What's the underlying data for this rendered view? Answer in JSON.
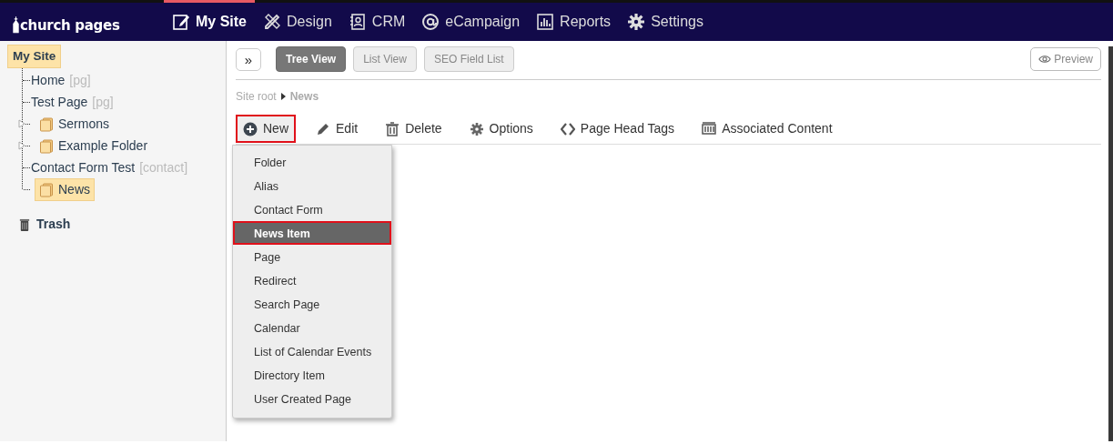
{
  "brand": "church pages",
  "nav": [
    {
      "label": "My Site",
      "selected": true
    },
    {
      "label": "Design",
      "selected": false
    },
    {
      "label": "CRM",
      "selected": false
    },
    {
      "label": "eCampaign",
      "selected": false
    },
    {
      "label": "Reports",
      "selected": false
    },
    {
      "label": "Settings",
      "selected": false
    }
  ],
  "tree": {
    "label": "My Site",
    "selected": true,
    "children": [
      {
        "label": "Home",
        "tag": "[pg]",
        "kind": "page",
        "collapsible": false,
        "selected": false
      },
      {
        "label": "Test Page",
        "tag": "[pg]",
        "kind": "page",
        "collapsible": false,
        "selected": false
      },
      {
        "label": "Sermons",
        "kind": "folder",
        "collapsible": true,
        "selected": false
      },
      {
        "label": "Example Folder",
        "kind": "folder",
        "collapsible": true,
        "selected": false
      },
      {
        "label": "Contact Form Test",
        "tag": "[contact]",
        "kind": "page",
        "collapsible": false,
        "selected": false
      },
      {
        "label": "News",
        "kind": "folder",
        "collapsible": false,
        "selected": true
      }
    ]
  },
  "trash": "Trash",
  "expand_button": "»",
  "view_tabs": [
    {
      "label": "Tree View",
      "selected": true
    },
    {
      "label": "List View",
      "selected": false
    },
    {
      "label": "SEO Field List",
      "selected": false
    }
  ],
  "preview": "Preview",
  "breadcrumb": [
    "Site root",
    "News"
  ],
  "toolbar": [
    {
      "label": "New",
      "highlighted": true
    },
    {
      "label": "Edit",
      "highlighted": false
    },
    {
      "label": "Delete",
      "highlighted": false
    },
    {
      "label": "Options",
      "highlighted": false
    },
    {
      "label": "Page Head Tags",
      "highlighted": false
    },
    {
      "label": "Associated Content",
      "highlighted": false
    }
  ],
  "new_menu": [
    {
      "label": "Folder",
      "selected": false,
      "highlighted": false
    },
    {
      "label": "Alias",
      "selected": false,
      "highlighted": false
    },
    {
      "label": "Contact Form",
      "selected": false,
      "highlighted": false
    },
    {
      "label": "News Item",
      "selected": true,
      "highlighted": true
    },
    {
      "label": "Page",
      "selected": false,
      "highlighted": false
    },
    {
      "label": "Redirect",
      "selected": false,
      "highlighted": false
    },
    {
      "label": "Search Page",
      "selected": false,
      "highlighted": false
    },
    {
      "label": "Calendar",
      "selected": false,
      "highlighted": false
    },
    {
      "label": "List of Calendar Events",
      "selected": false,
      "highlighted": false
    },
    {
      "label": "Directory Item",
      "selected": false,
      "highlighted": false
    },
    {
      "label": "User Created Page",
      "selected": false,
      "highlighted": false
    }
  ]
}
